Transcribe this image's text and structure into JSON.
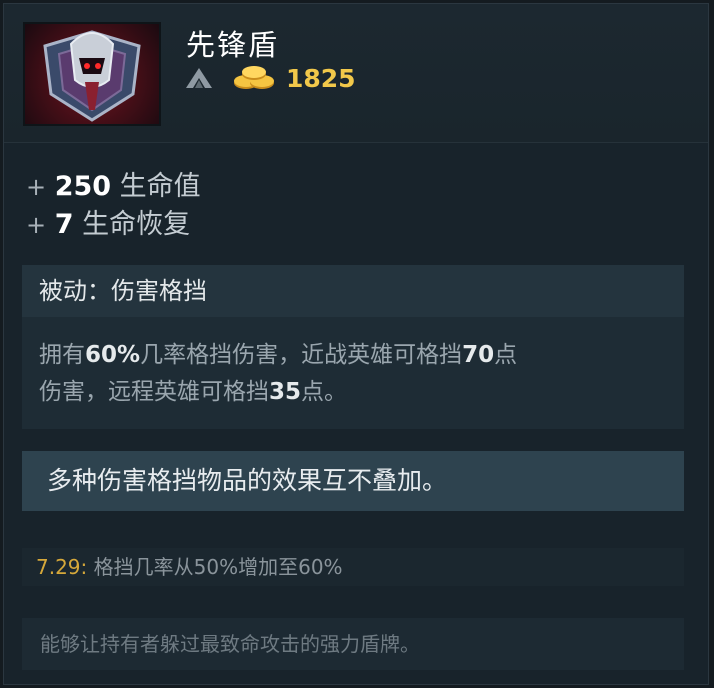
{
  "item": {
    "name": "先锋盾",
    "cost": "1825",
    "icon": "vanguard-shield-icon",
    "shop_icon": "side-shop-icon",
    "gold_icon": "gold-coins-icon"
  },
  "stats": [
    {
      "plus": "+",
      "value": "250",
      "name": "生命值"
    },
    {
      "plus": "+",
      "value": "7",
      "name": "生命恢复"
    }
  ],
  "ability": {
    "title": "被动：伤害格挡",
    "desc_parts": {
      "p1": "拥有",
      "v1": "60%",
      "p2": "几率格挡伤害，近战英雄可格挡",
      "v2": "70",
      "p3": "点",
      "p4": "伤害，远程英雄可格挡",
      "v3": "35",
      "p5": "点。"
    }
  },
  "note": "多种伤害格挡物品的效果互不叠加。",
  "patch": {
    "version": "7.29:",
    "text": "格挡几率从50%增加至60%"
  },
  "lore": "能够让持有者躲过最致命攻击的强力盾牌。",
  "colors": {
    "gold": "#f2c84a",
    "patch_version": "#d6a83a",
    "background": "#18232b"
  }
}
